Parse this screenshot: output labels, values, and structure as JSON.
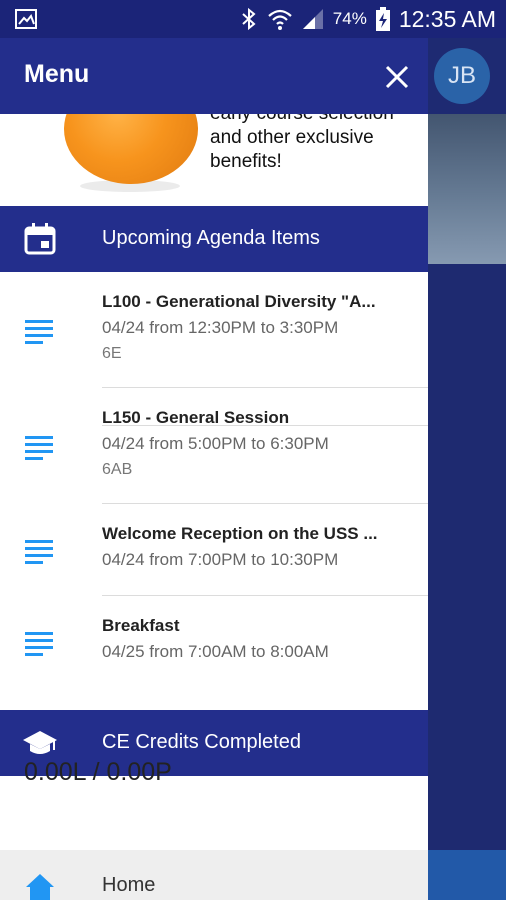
{
  "status_bar": {
    "battery_percent": "74%",
    "time": "12:35 AM",
    "icons": [
      "gallery-icon",
      "bluetooth-icon",
      "wifi-icon",
      "signal-icon",
      "battery-charging-icon"
    ]
  },
  "header": {
    "title": "Menu",
    "close_icon": "close-icon"
  },
  "avatar": {
    "initials": "JB"
  },
  "promo": {
    "text": "early course selection and other exclusive benefits!"
  },
  "agenda": {
    "section_label": "Upcoming Agenda Items",
    "section_icon": "calendar-icon",
    "items": [
      {
        "title": "L100 - Generational Diversity \"A...",
        "time": "04/24 from 12:30PM to 3:30PM",
        "room": "6E"
      },
      {
        "title": "L150 - General Session",
        "time": "04/24 from 5:00PM to 6:30PM",
        "room": "6AB"
      },
      {
        "title": "Welcome Reception on the USS ...",
        "time": "04/24 from 7:00PM to 10:30PM",
        "room": ""
      },
      {
        "title": "Breakfast",
        "time": "04/25 from 7:00AM to 8:00AM",
        "room": ""
      }
    ]
  },
  "ce": {
    "section_label": "CE Credits Completed",
    "section_icon": "graduation-cap-icon",
    "value": "0.00L / 0.00P"
  },
  "nav": {
    "home_label": "Home",
    "home_icon": "home-icon"
  },
  "colors": {
    "primary": "#232e8c",
    "accent": "#2196f3",
    "status_bar": "#1b2478"
  }
}
